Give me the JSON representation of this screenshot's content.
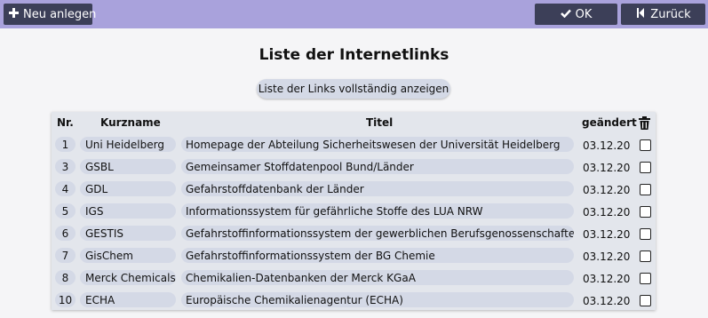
{
  "toolbar": {
    "new_label": "Neu anlegen",
    "ok_label": "OK",
    "back_label": "Zurück"
  },
  "page": {
    "title": "Liste der Internetlinks",
    "show_all_label": "Liste der Links vollständig anzeigen"
  },
  "table": {
    "headers": {
      "nr": "Nr.",
      "kurzname": "Kurzname",
      "titel": "Titel",
      "geaendert": "geändert"
    },
    "rows": [
      {
        "nr": "1",
        "kurzname": "Uni Heidelberg",
        "titel": "Homepage der Abteilung Sicherheitswesen der Universität Heidelberg",
        "date": "03.12.20"
      },
      {
        "nr": "3",
        "kurzname": "GSBL",
        "titel": "Gemeinsamer Stoffdatenpool Bund/Länder",
        "date": "03.12.20"
      },
      {
        "nr": "4",
        "kurzname": "GDL",
        "titel": "Gefahrstoffdatenbank der Länder",
        "date": "03.12.20"
      },
      {
        "nr": "5",
        "kurzname": "IGS",
        "titel": "Informationssystem für gefährliche Stoffe des LUA NRW",
        "date": "03.12.20"
      },
      {
        "nr": "6",
        "kurzname": "GESTIS",
        "titel": "Gefahrstoffinformationssystem der gewerblichen Berufsgenossenschaften",
        "date": "03.12.20"
      },
      {
        "nr": "7",
        "kurzname": "GisChem",
        "titel": "Gefahrstoffinformationssystem der BG Chemie",
        "date": "03.12.20"
      },
      {
        "nr": "8",
        "kurzname": "Merck Chemicals",
        "titel": "Chemikalien-Datenbanken der Merck KGaA",
        "date": "03.12.20"
      },
      {
        "nr": "10",
        "kurzname": "ECHA",
        "titel": "Europäische Chemikalienagentur (ECHA)",
        "date": "03.12.20"
      }
    ]
  },
  "icons": {
    "new": "plus-icon",
    "ok": "check-icon",
    "back": "skip-back-icon",
    "delete": "trash-icon"
  },
  "colors": {
    "topbar": "#a9a2dc",
    "button": "#3c3f58",
    "pill": "#d4d9e6",
    "table_bg": "#e3e6ec"
  }
}
